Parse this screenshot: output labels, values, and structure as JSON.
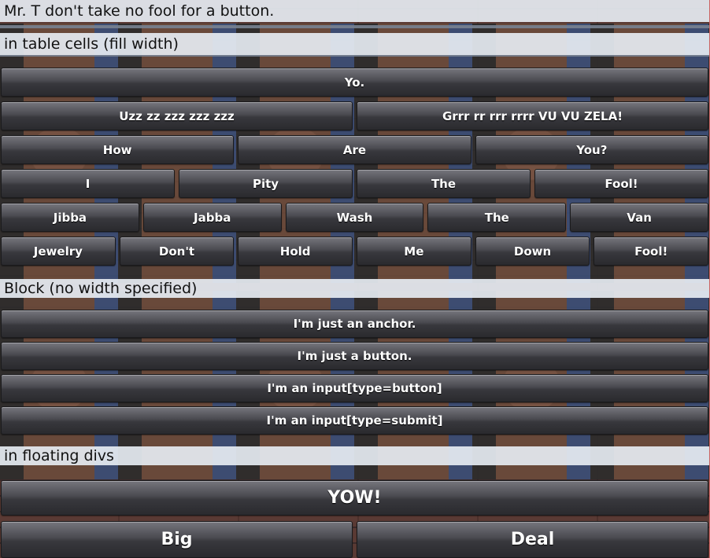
{
  "header": "Mr. T don't take no fool for a button.",
  "sections": {
    "table_cells": "in table cells (fill width)",
    "block": "Block (no width specified)",
    "floating": "in floating divs"
  },
  "table_rows": [
    [
      "Yo."
    ],
    [
      "Uzz zz zzz zzz zzz",
      "Grrr rr rrr rrrr VU VU ZELA!"
    ],
    [
      "How",
      "Are",
      "You?"
    ],
    [
      "I",
      "Pity",
      "The",
      "Fool!"
    ],
    [
      "Jibba",
      "Jabba",
      "Wash",
      "The",
      "Van"
    ],
    [
      "Jewelry",
      "Don't",
      "Hold",
      "Me",
      "Down",
      "Fool!"
    ]
  ],
  "block_buttons": {
    "anchor": "I'm just an anchor.",
    "button": "I'm just a button.",
    "input_button": "I'm an input[type=button]",
    "input_submit": "I'm an input[type=submit]"
  },
  "floating_buttons": {
    "yow": "YOW!",
    "big": "Big",
    "deal": "Deal"
  }
}
